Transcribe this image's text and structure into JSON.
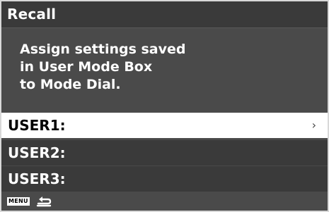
{
  "header": {
    "title": "Recall"
  },
  "description": {
    "lines": [
      "Assign settings saved",
      "in User Mode Box",
      "to Mode Dial."
    ]
  },
  "menu": {
    "items": [
      {
        "label": "USER1:",
        "selected": true,
        "chevron": "›"
      },
      {
        "label": "USER2:",
        "selected": false
      },
      {
        "label": "USER3:",
        "selected": false
      }
    ]
  },
  "footer": {
    "menu_label": "MENU",
    "back_icon": "return-arrow-icon"
  }
}
